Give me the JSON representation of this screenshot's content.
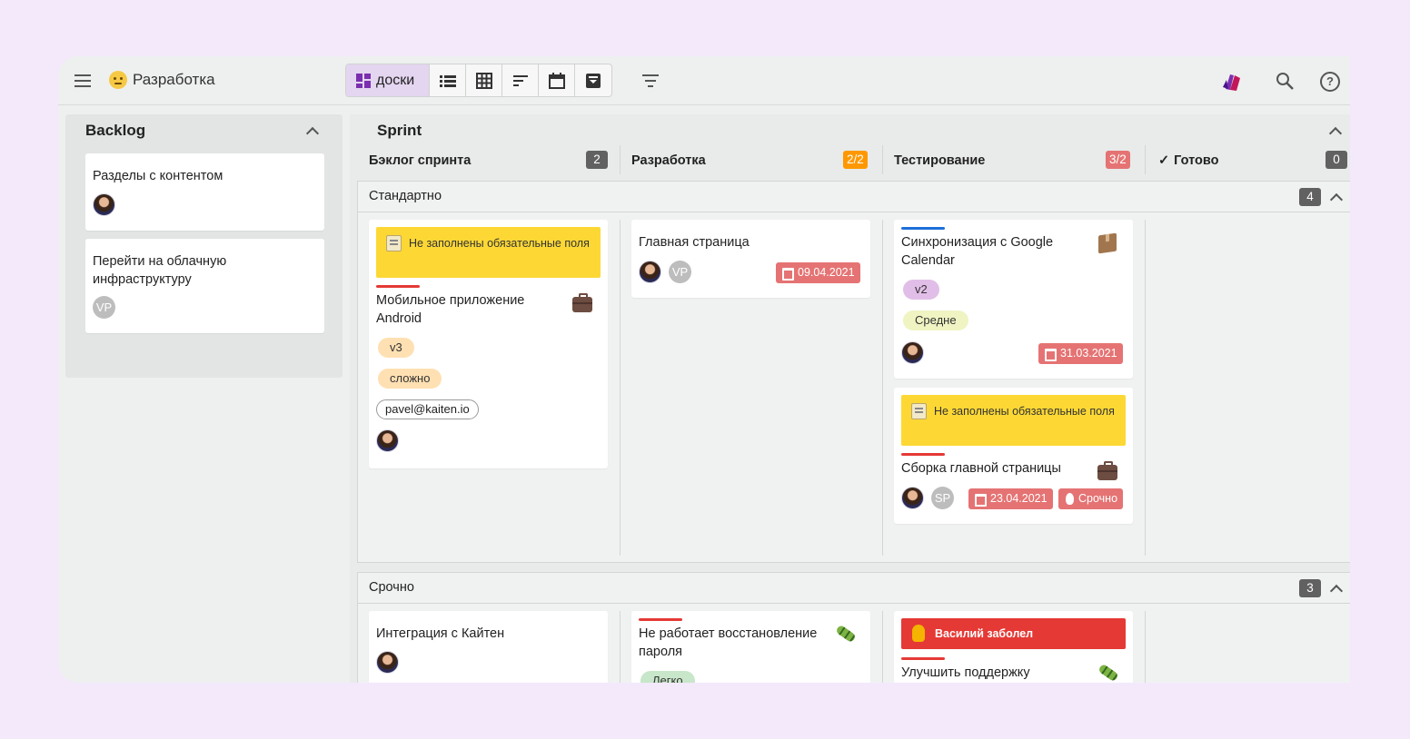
{
  "app": {
    "board_title": "Разработка",
    "views": {
      "boards_label": "доски"
    }
  },
  "icons": {
    "menu": "hamburger-menu-icon",
    "board_emoji": "smiley-icon",
    "views": [
      "boards-icon",
      "list-icon",
      "table-icon",
      "timeline-icon",
      "calendar-icon",
      "archive-icon"
    ],
    "filter": "filter-icon",
    "logo": "kaiten-logo-icon",
    "search": "search-icon",
    "help": "help-icon"
  },
  "colors": {
    "accent": "#7b2fb0",
    "warning_banner": "#fdd835",
    "sick_banner": "#e53935",
    "date_badge": "#e57373",
    "count_gray": "#616161",
    "count_orange": "#ff9800",
    "count_red": "#e57373"
  },
  "backlog": {
    "title": "Backlog",
    "cards": [
      {
        "title": "Разделы с контентом",
        "members": [
          "avatar"
        ]
      },
      {
        "title": "Перейти на облачную инфраструктуру",
        "members": [
          "VP"
        ]
      }
    ]
  },
  "sprint": {
    "title": "Sprint",
    "columns": [
      {
        "name": "Бэклог спринта",
        "count": "2"
      },
      {
        "name": "Разработка",
        "count": "2/2"
      },
      {
        "name": "Тестирование",
        "count": "3/2"
      },
      {
        "name": "Готово",
        "check": "✓",
        "count": "0"
      }
    ],
    "lanes": [
      {
        "title": "Стандартно",
        "count": "4",
        "cards": {
          "mobile": {
            "warning": "Не заполнены обязательные поля",
            "title": "Мобильное приложение Android",
            "tags": [
              "v3",
              "сложно"
            ],
            "email": "pavel@kaiten.io",
            "type_icon": "briefcase-icon"
          },
          "main_page": {
            "title": "Главная страница",
            "members": [
              "avatar",
              "VP"
            ],
            "due": "09.04.2021"
          },
          "gcal": {
            "title": "Синхронизация с Google Calendar",
            "tags": [
              "v2",
              "Средне"
            ],
            "due": "31.03.2021",
            "type_icon": "package-icon"
          },
          "build": {
            "warning": "Не заполнены обязательные поля",
            "title": "Сборка главной страницы",
            "members": [
              "avatar",
              "SP"
            ],
            "due": "23.04.2021",
            "urgent": "Срочно",
            "type_icon": "briefcase-icon"
          }
        }
      },
      {
        "title": "Срочно",
        "count": "3",
        "cards": {
          "kaiten": {
            "title": "Интеграция с Кайтен"
          },
          "password": {
            "title": "Не работает восстановление пароля",
            "tag": "Легко",
            "type_icon": "bug-icon"
          },
          "support": {
            "banner": "Василий заболел",
            "title": "Улучшить поддержку",
            "type_icon": "bug-icon"
          }
        }
      }
    ]
  }
}
